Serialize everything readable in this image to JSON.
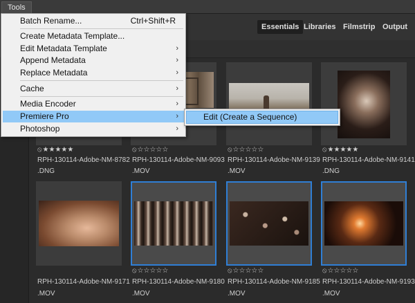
{
  "menubar": {
    "tools_label": "Tools"
  },
  "workspaces": {
    "essentials": "Essentials",
    "libraries": "Libraries",
    "filmstrip": "Filmstrip",
    "output": "Output",
    "active": "Essentials"
  },
  "tools_menu": {
    "batch_rename": "Batch Rename...",
    "batch_rename_shortcut": "Ctrl+Shift+R",
    "create_metadata_template": "Create Metadata Template...",
    "edit_metadata_template": "Edit Metadata Template",
    "append_metadata": "Append Metadata",
    "replace_metadata": "Replace Metadata",
    "cache": "Cache",
    "media_encoder": "Media Encoder",
    "premiere_pro": "Premiere Pro",
    "photoshop": "Photoshop",
    "submenu_arrow": "›"
  },
  "premiere_submenu": {
    "edit_create_sequence": "Edit (Create a Sequence)"
  },
  "thumbnails": [
    {
      "name": "RPH-130114-Adobe-NM-8782",
      "ext": ".DNG",
      "stars": 5,
      "filled": 5
    },
    {
      "name": "RPH-130114-Adobe-NM-9093",
      "ext": ".MOV",
      "stars": 5,
      "filled": 0
    },
    {
      "name": "RPH-130114-Adobe-NM-9139",
      "ext": ".MOV",
      "stars": 5,
      "filled": 0
    },
    {
      "name": "RPH-130114-Adobe-NM-9141",
      "ext": ".DNG",
      "stars": 5,
      "filled": 5
    },
    {
      "name": "RPH-130114-Adobe-NM-9171",
      "ext": ".MOV",
      "stars": 5,
      "filled": 0
    },
    {
      "name": "RPH-130114-Adobe-NM-9180",
      "ext": ".MOV",
      "stars": 5,
      "filled": 0
    },
    {
      "name": "RPH-130114-Adobe-NM-9185",
      "ext": ".MOV",
      "stars": 5,
      "filled": 0
    },
    {
      "name": "RPH-130114-Adobe-NM-9193",
      "ext": ".MOV",
      "stars": 5,
      "filled": 0
    }
  ],
  "colors": {
    "selection": "#2f7fd6",
    "menu_highlight": "#91c9f7"
  }
}
